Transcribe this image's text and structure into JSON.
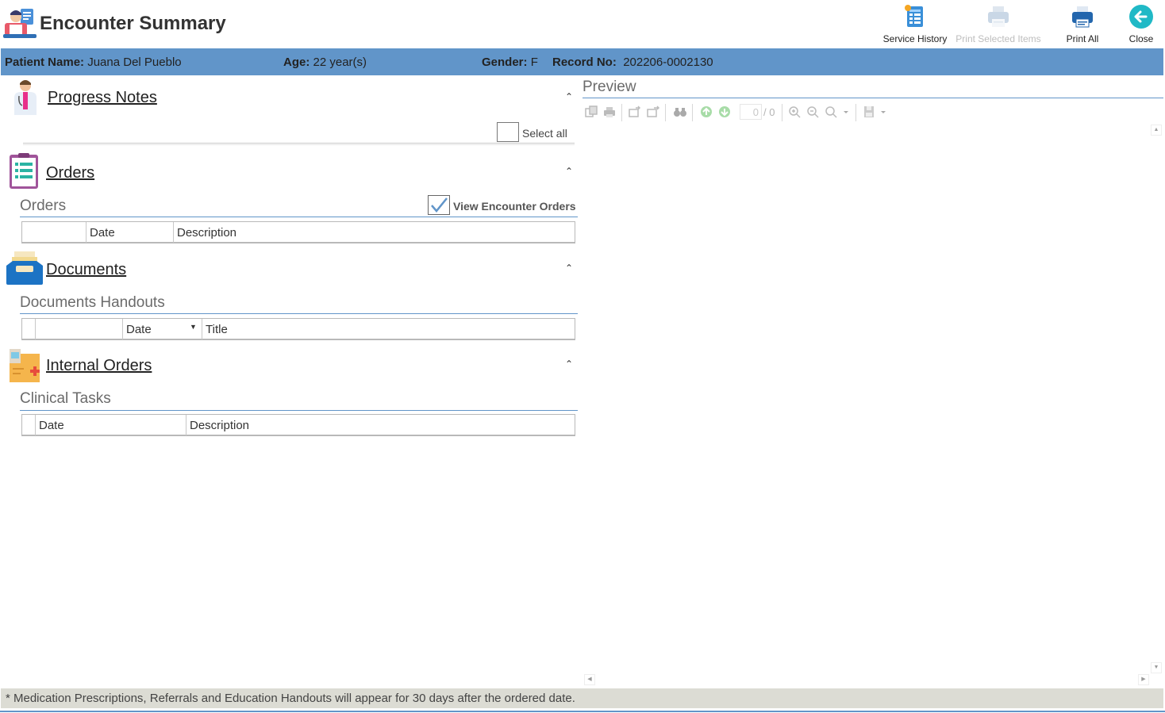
{
  "app": {
    "title": "Encounter Summary"
  },
  "toolbar": {
    "service_history": "Service History",
    "print_selected": "Print Selected Items",
    "print_all": "Print All",
    "close": "Close"
  },
  "patient": {
    "name_label": "Patient Name:",
    "name": "Juana Del Pueblo",
    "age_label": "Age:",
    "age": "22 year(s)",
    "gender_label": "Gender:",
    "gender": "F",
    "record_label": "Record No:",
    "record": "202206-0002130"
  },
  "sections": {
    "progress_notes": {
      "title": "Progress Notes",
      "select_all": "Select all"
    },
    "orders": {
      "title": "Orders",
      "subtitle": "Orders",
      "view_encounter_orders": "View Encounter Orders",
      "view_encounter_orders_checked": true,
      "columns": [
        "Date",
        "Description"
      ]
    },
    "documents": {
      "title": "Documents",
      "subtitle": "Documents Handouts",
      "columns": [
        "Date",
        "Title"
      ]
    },
    "internal_orders": {
      "title": "Internal Orders",
      "subtitle": "Clinical Tasks",
      "columns": [
        "Date",
        "Description"
      ]
    }
  },
  "preview": {
    "title": "Preview",
    "page_current": "0",
    "page_total": "/ 0"
  },
  "footer": {
    "note": "* Medication Prescriptions, Referrals and Education Handouts will appear for 30 days after the ordered date."
  },
  "colors": {
    "accent": "#6195c9",
    "footer_bg": "#dcdcd4"
  }
}
